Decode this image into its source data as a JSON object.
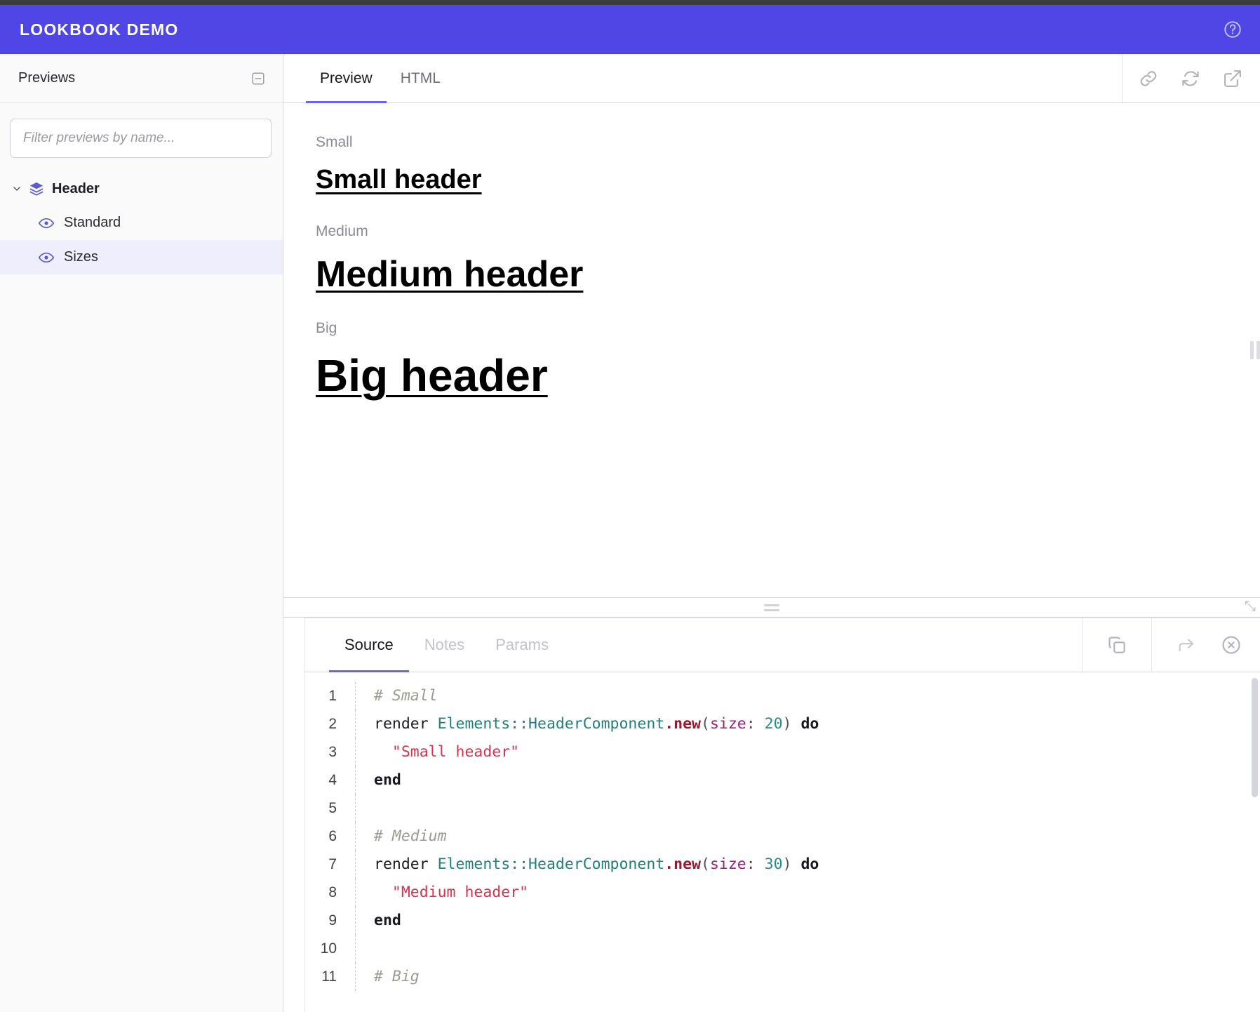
{
  "app": {
    "title": "LOOKBOOK DEMO",
    "accent_color": "#4f46e5",
    "help_icon": "question-circle-icon"
  },
  "sidebar": {
    "title": "Previews",
    "collapse_icon": "minus-square-icon",
    "filter": {
      "placeholder": "Filter previews by name...",
      "value": ""
    },
    "tree": [
      {
        "label": "Header",
        "icon": "layers-icon",
        "expanded": true,
        "children": [
          {
            "label": "Standard",
            "icon": "eye-icon",
            "selected": false
          },
          {
            "label": "Sizes",
            "icon": "eye-icon",
            "selected": true
          }
        ]
      }
    ]
  },
  "preview_panel": {
    "tabs": [
      {
        "label": "Preview",
        "active": true
      },
      {
        "label": "HTML",
        "active": false
      }
    ],
    "actions": [
      {
        "name": "copy-link-icon",
        "label": "link"
      },
      {
        "name": "refresh-icon",
        "label": "refresh"
      },
      {
        "name": "open-external-icon",
        "label": "open in new window"
      }
    ],
    "blocks": [
      {
        "label": "Small",
        "heading": "Small header"
      },
      {
        "label": "Medium",
        "heading": "Medium header"
      },
      {
        "label": "Big",
        "heading": "Big header"
      }
    ]
  },
  "source_panel": {
    "tabs": [
      {
        "label": "Source",
        "active": true,
        "disabled": false
      },
      {
        "label": "Notes",
        "active": false,
        "disabled": true
      },
      {
        "label": "Params",
        "active": false,
        "disabled": true
      }
    ],
    "actions": [
      {
        "name": "copy-icon",
        "label": "copy"
      },
      {
        "name": "share-arrow-icon",
        "label": "open"
      },
      {
        "name": "close-circle-icon",
        "label": "close"
      }
    ],
    "code_lines": [
      {
        "n": "1",
        "tokens": [
          {
            "t": "# Small",
            "c": "tok-comment"
          }
        ]
      },
      {
        "n": "2",
        "tokens": [
          {
            "t": "render ",
            "c": "tok-plain"
          },
          {
            "t": "Elements::HeaderComponent",
            "c": "tok-const"
          },
          {
            "t": ".",
            "c": "tok-method"
          },
          {
            "t": "new",
            "c": "tok-method"
          },
          {
            "t": "(",
            "c": "tok-punc"
          },
          {
            "t": "size:",
            "c": "tok-sym"
          },
          {
            "t": " ",
            "c": "tok-plain"
          },
          {
            "t": "20",
            "c": "tok-num"
          },
          {
            "t": ")",
            "c": "tok-punc"
          },
          {
            "t": " ",
            "c": "tok-plain"
          },
          {
            "t": "do",
            "c": "tok-kw"
          }
        ]
      },
      {
        "n": "3",
        "tokens": [
          {
            "t": "  \"Small header\"",
            "c": "tok-str"
          }
        ]
      },
      {
        "n": "4",
        "tokens": [
          {
            "t": "end",
            "c": "tok-kw"
          }
        ]
      },
      {
        "n": "5",
        "tokens": [
          {
            "t": "",
            "c": "tok-plain"
          }
        ]
      },
      {
        "n": "6",
        "tokens": [
          {
            "t": "# Medium",
            "c": "tok-comment"
          }
        ]
      },
      {
        "n": "7",
        "tokens": [
          {
            "t": "render ",
            "c": "tok-plain"
          },
          {
            "t": "Elements::HeaderComponent",
            "c": "tok-const"
          },
          {
            "t": ".",
            "c": "tok-method"
          },
          {
            "t": "new",
            "c": "tok-method"
          },
          {
            "t": "(",
            "c": "tok-punc"
          },
          {
            "t": "size:",
            "c": "tok-sym"
          },
          {
            "t": " ",
            "c": "tok-plain"
          },
          {
            "t": "30",
            "c": "tok-num"
          },
          {
            "t": ")",
            "c": "tok-punc"
          },
          {
            "t": " ",
            "c": "tok-plain"
          },
          {
            "t": "do",
            "c": "tok-kw"
          }
        ]
      },
      {
        "n": "8",
        "tokens": [
          {
            "t": "  \"Medium header\"",
            "c": "tok-str"
          }
        ]
      },
      {
        "n": "9",
        "tokens": [
          {
            "t": "end",
            "c": "tok-kw"
          }
        ]
      },
      {
        "n": "10",
        "tokens": [
          {
            "t": "",
            "c": "tok-plain"
          }
        ]
      },
      {
        "n": "11",
        "tokens": [
          {
            "t": "# Big",
            "c": "tok-comment"
          }
        ]
      }
    ]
  }
}
